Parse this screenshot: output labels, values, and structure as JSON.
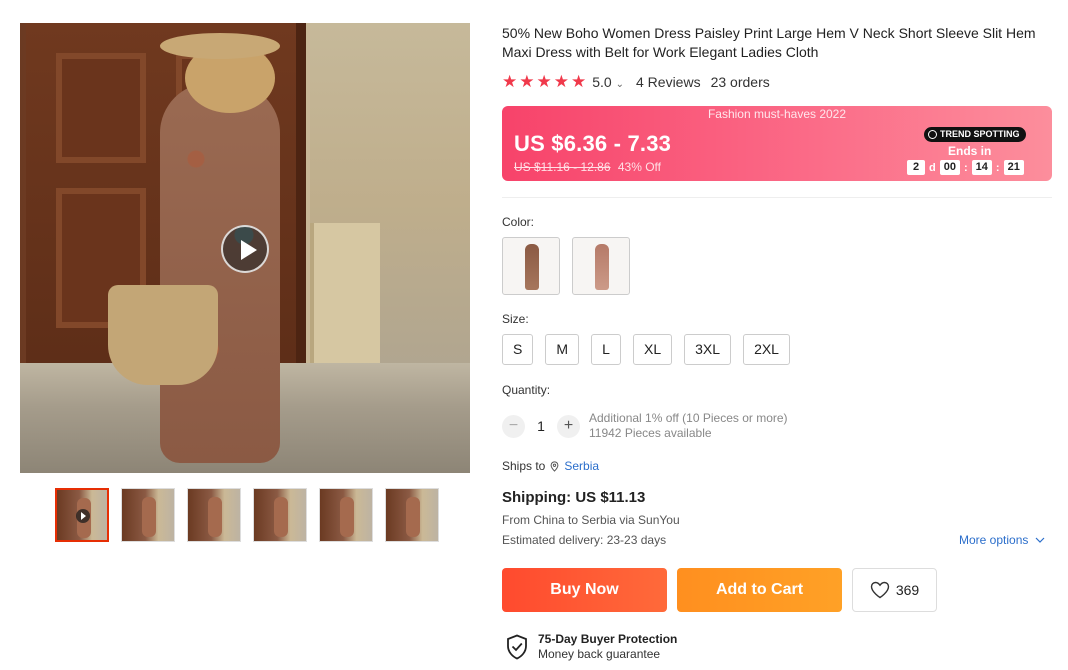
{
  "product": {
    "title": "50% New Boho Women Dress Paisley Print Large Hem V Neck Short Sleeve Slit Hem Maxi Dress with Belt for Work Elegant Ladies Cloth",
    "rating": "5.0",
    "rating_stars": 5,
    "reviews": "4 Reviews",
    "orders": "23 orders"
  },
  "promo": {
    "banner": "Fashion must-haves 2022",
    "price": "US $6.36 - 7.33",
    "old_price": "US $11.16 - 12.86",
    "discount": "43% Off",
    "badge": "TREND SPOTTING",
    "ends_in": "Ends in",
    "countdown": {
      "days": "2",
      "days_unit": "d",
      "hours": "00",
      "minutes": "14",
      "seconds": "21"
    },
    "colors": {
      "start": "#f7436a",
      "end": "#fc8e9c"
    }
  },
  "color": {
    "label": "Color:",
    "options": [
      {
        "icon": "dress-thumbnail-brown"
      },
      {
        "icon": "dress-thumbnail-pink"
      }
    ]
  },
  "size": {
    "label": "Size:",
    "options": [
      "S",
      "M",
      "L",
      "XL",
      "3XL",
      "2XL"
    ]
  },
  "quantity": {
    "label": "Quantity:",
    "value": "1",
    "minus": "−",
    "plus": "+",
    "note": "Additional 1% off (10 Pieces or more)",
    "available": "11942 Pieces available"
  },
  "shipping": {
    "ships_to_label": "Ships to",
    "ships_to_country": "Serbia",
    "cost": "Shipping: US $11.13",
    "route": "From China to Serbia via SunYou",
    "estimate": "Estimated delivery: 23-23 days",
    "more_options": "More options"
  },
  "actions": {
    "buy_now": "Buy Now",
    "add_to_cart": "Add to Cart",
    "wishlist_count": "369"
  },
  "protection": {
    "title": "75-Day Buyer Protection",
    "subtitle": "Money back guarantee"
  },
  "gallery": {
    "thumbnail_count": 6,
    "active_index": 0
  },
  "theme": {
    "accent": "#e62e04",
    "star_color": "#f0394b",
    "link_color": "#2b6ecb",
    "buy_color": "#ff4a2e",
    "cart_color": "#ff8f1f"
  }
}
